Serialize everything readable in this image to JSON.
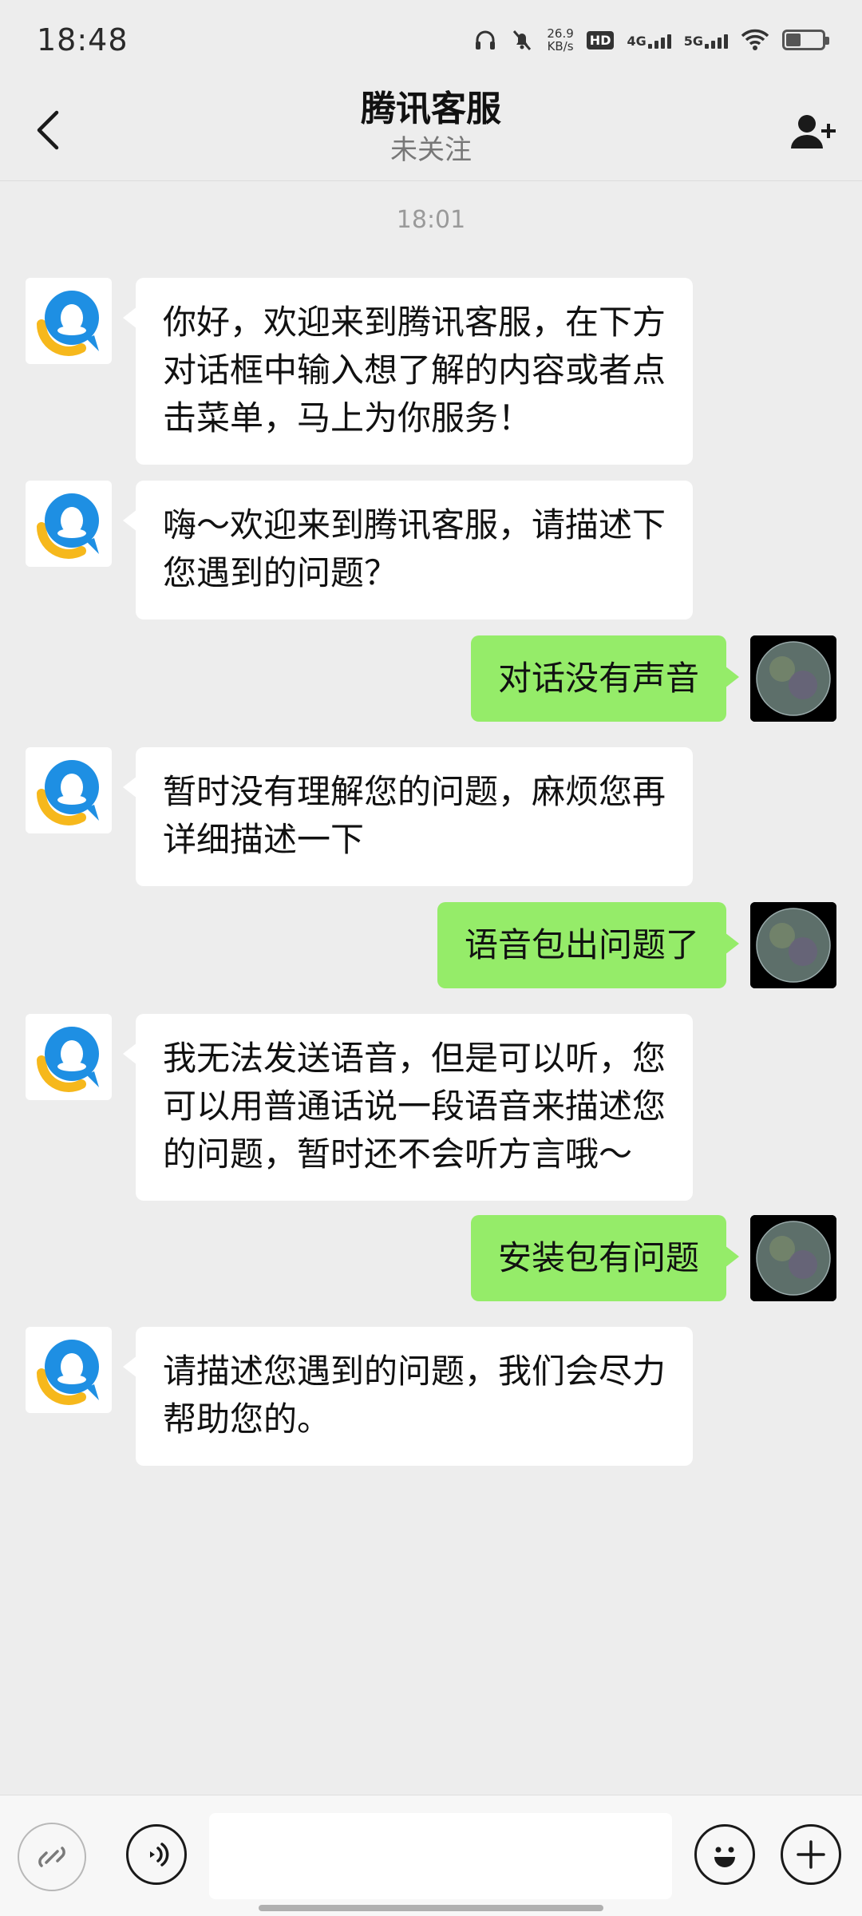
{
  "status_bar": {
    "time": "18:48",
    "net_speed_value": "26.9",
    "net_speed_unit": "KB/s",
    "hd_label": "HD",
    "sim1_label": "4G",
    "sim2_label": "5G",
    "icons": [
      "headphones-icon",
      "mute-icon",
      "wifi-icon",
      "battery-icon"
    ]
  },
  "header": {
    "title": "腾讯客服",
    "subtitle": "未关注"
  },
  "timestamp": "18:01",
  "messages": [
    {
      "from": "bot",
      "lines": [
        "你好，欢迎来到腾讯客服，在下方",
        "对话框中输入想了解的内容或者点",
        "击菜单，马上为你服务！"
      ]
    },
    {
      "from": "bot",
      "lines": [
        "嗨～欢迎来到腾讯客服，请描述下",
        "您遇到的问题？"
      ]
    },
    {
      "from": "user",
      "text": "对话没有声音"
    },
    {
      "from": "bot",
      "lines": [
        "暂时没有理解您的问题，麻烦您再",
        "详细描述一下"
      ]
    },
    {
      "from": "user",
      "text": "语音包出问题了"
    },
    {
      "from": "bot",
      "lines": [
        "我无法发送语音，但是可以听，您",
        "可以用普通话说一段语音来描述您",
        "的问题，暂时还不会听方言哦～"
      ]
    },
    {
      "from": "user",
      "text": "安装包有问题"
    },
    {
      "from": "bot",
      "lines": [
        "请描述您遇到的问题，我们会尽力",
        "帮助您的。"
      ]
    }
  ],
  "input_bar": {
    "input_value": "",
    "icons": [
      "mini-program-icon",
      "voice-icon",
      "emoji-icon",
      "plus-icon"
    ]
  },
  "colors": {
    "background": "#ededed",
    "outgoing_bubble": "#95ec69",
    "incoming_bubble": "#ffffff",
    "bot_avatar_blue": "#1e8fe3",
    "bot_avatar_yellow": "#f6b81c"
  }
}
